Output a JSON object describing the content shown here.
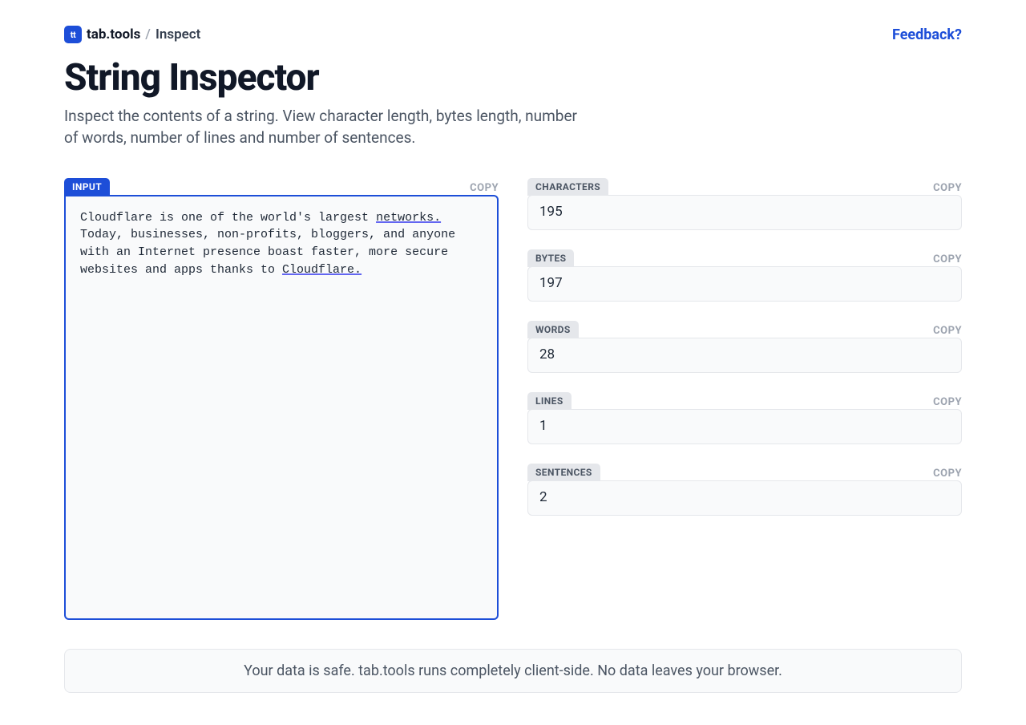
{
  "header": {
    "logo_text": "tt",
    "brand": "tab.tools",
    "separator": "/",
    "crumb": "Inspect",
    "feedback": "Feedback?"
  },
  "page": {
    "title": "String Inspector",
    "subtitle": "Inspect the contents of a string. View character length, bytes length, number of words, number of lines and number of sentences."
  },
  "input": {
    "label": "INPUT",
    "copy": "COPY",
    "value_pre": "Cloudflare is one of the world's largest ",
    "value_u1": "networks.",
    "value_mid": " Today, businesses, non-profits, bloggers, and anyone with an Internet presence boast faster, more secure websites and apps thanks to ",
    "value_u2": "Cloudflare."
  },
  "outputs": [
    {
      "label": "CHARACTERS",
      "value": "195",
      "copy": "COPY"
    },
    {
      "label": "BYTES",
      "value": "197",
      "copy": "COPY"
    },
    {
      "label": "WORDS",
      "value": "28",
      "copy": "COPY"
    },
    {
      "label": "LINES",
      "value": "1",
      "copy": "COPY"
    },
    {
      "label": "SENTENCES",
      "value": "2",
      "copy": "COPY"
    }
  ],
  "footer": {
    "text": "Your data is safe. tab.tools runs completely client-side. No data leaves your browser."
  }
}
